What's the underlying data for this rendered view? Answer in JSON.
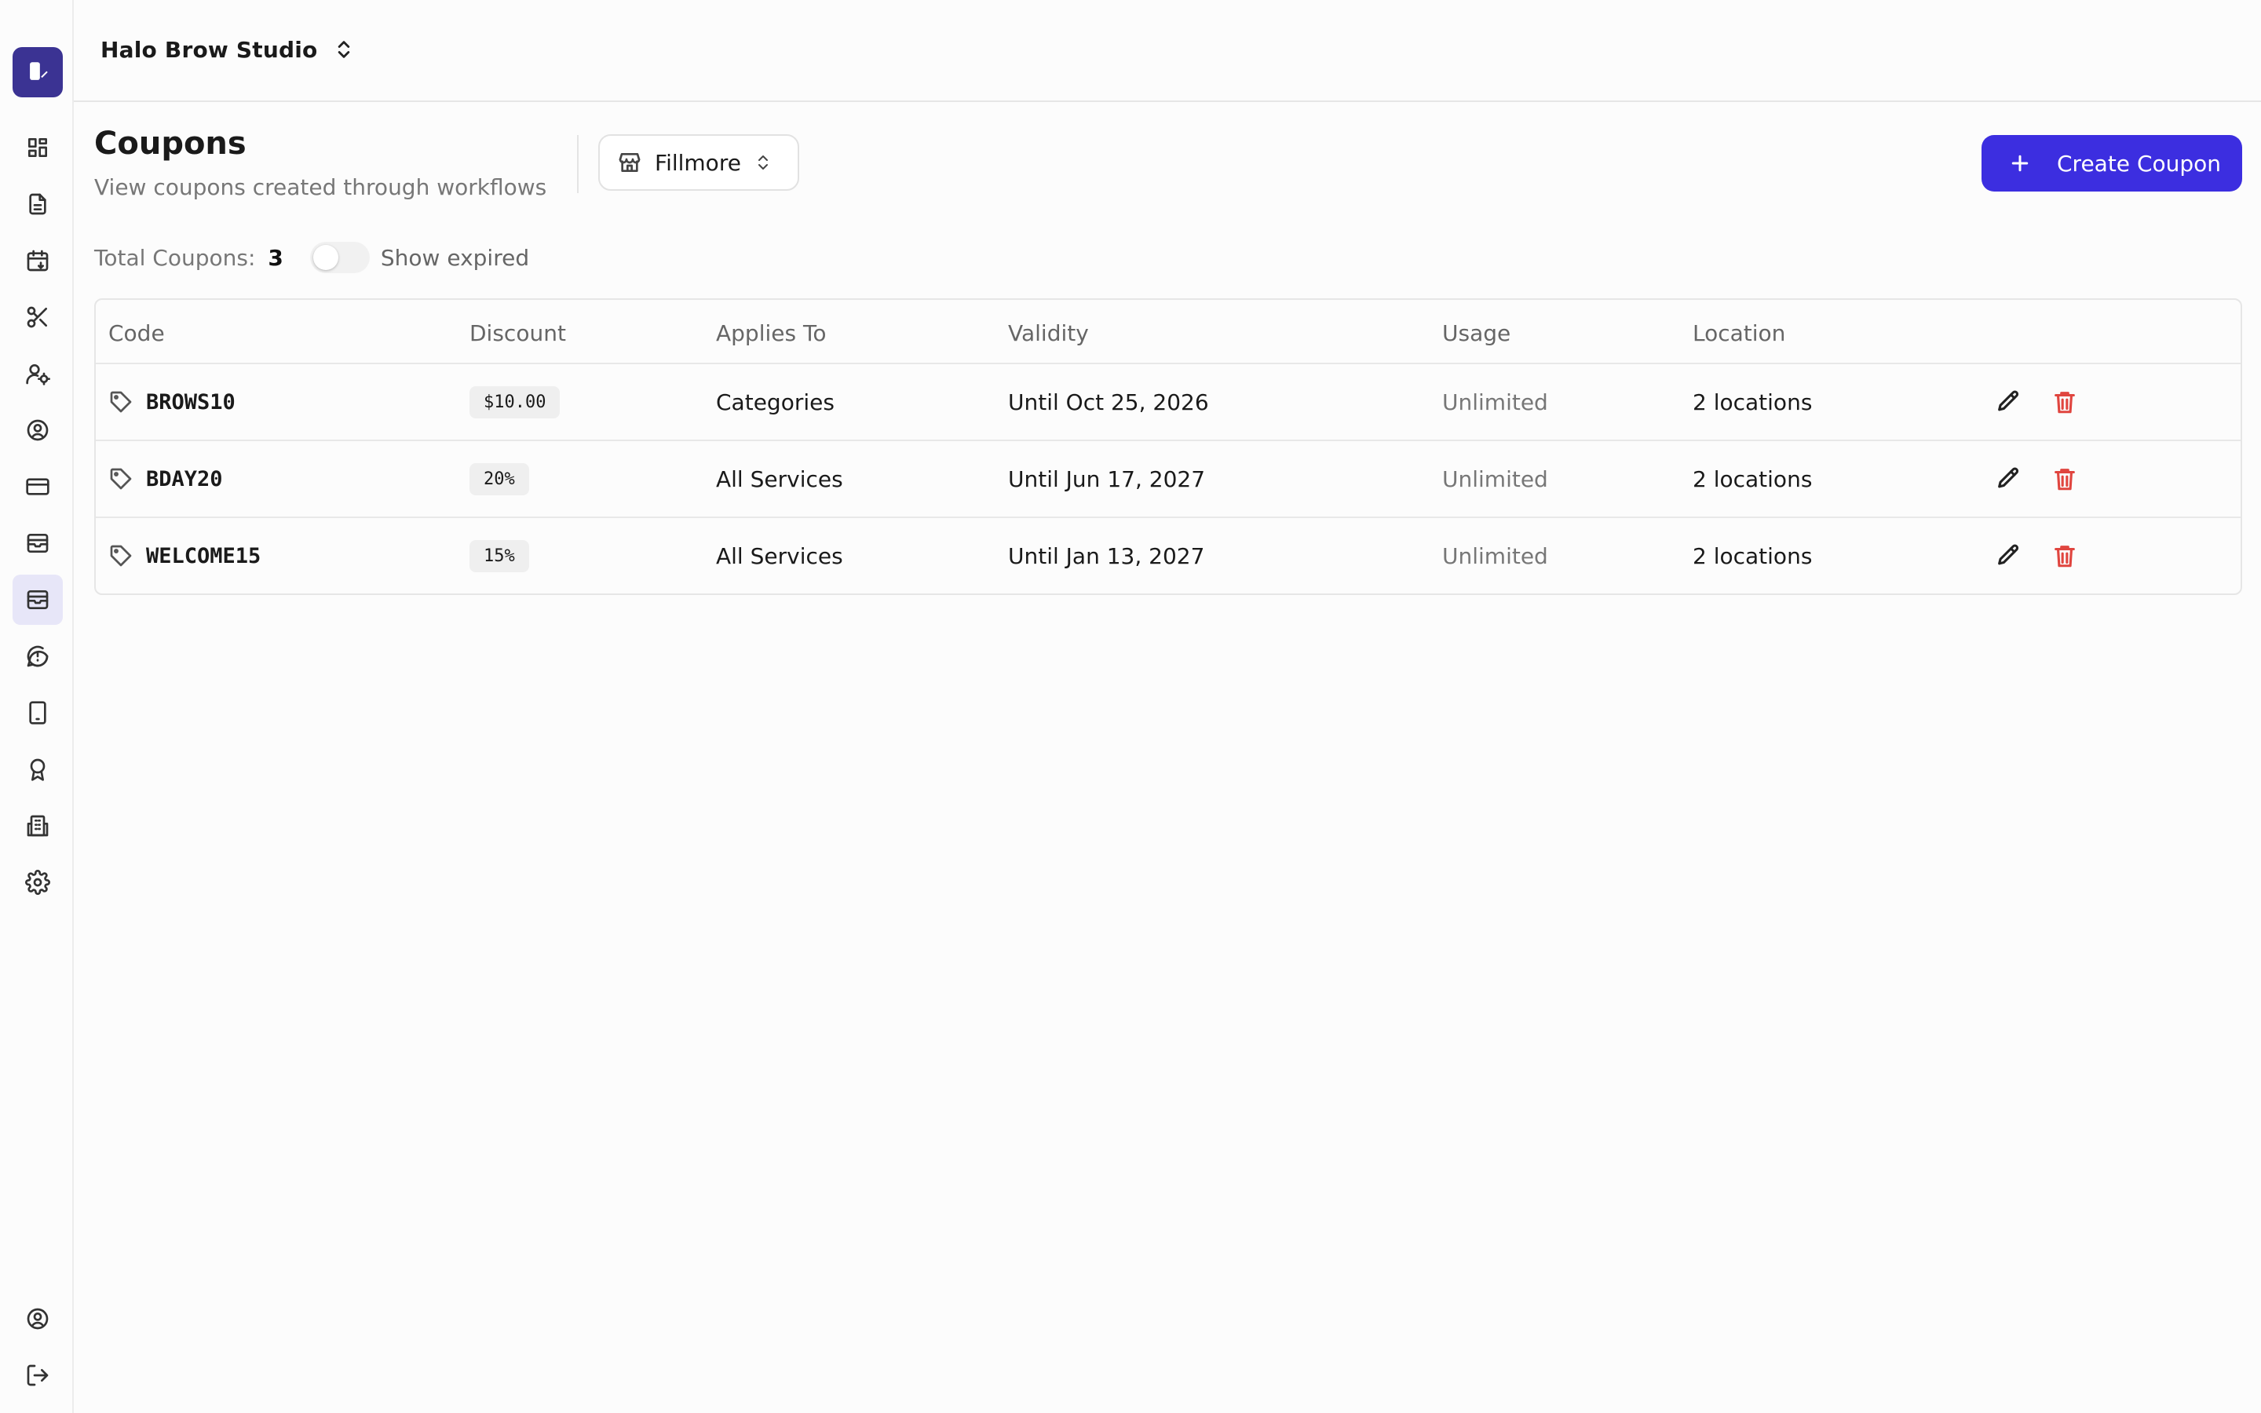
{
  "header": {
    "studio_name": "Halo Brow Studio"
  },
  "page": {
    "title": "Coupons",
    "subtitle": "View coupons created through workflows"
  },
  "location_select": {
    "value": "Fillmore"
  },
  "create_button": {
    "label": "Create Coupon"
  },
  "summary": {
    "total_label": "Total Coupons:",
    "total_count": "3",
    "show_expired_label": "Show expired",
    "show_expired_on": false
  },
  "table": {
    "columns": [
      "Code",
      "Discount",
      "Applies To",
      "Validity",
      "Usage",
      "Location"
    ],
    "rows": [
      {
        "code": "BROWS10",
        "discount": "$10.00",
        "applies_to": "Categories",
        "validity": "Until Oct 25, 2026",
        "usage": "Unlimited",
        "location": "2 locations"
      },
      {
        "code": "BDAY20",
        "discount": "20%",
        "applies_to": "All Services",
        "validity": "Until Jun 17, 2027",
        "usage": "Unlimited",
        "location": "2 locations"
      },
      {
        "code": "WELCOME15",
        "discount": "15%",
        "applies_to": "All Services",
        "validity": "Until Jan 13, 2027",
        "usage": "Unlimited",
        "location": "2 locations"
      }
    ]
  },
  "sidebar": {
    "items": [
      {
        "icon": "dashboard-icon"
      },
      {
        "icon": "document-icon"
      },
      {
        "icon": "calendar-icon"
      },
      {
        "icon": "scissors-icon"
      },
      {
        "icon": "staff-icon"
      },
      {
        "icon": "user-circle-icon"
      },
      {
        "icon": "credit-card-icon"
      },
      {
        "icon": "archive-icon"
      },
      {
        "icon": "coupons-icon",
        "active": true
      },
      {
        "icon": "chat-icon"
      },
      {
        "icon": "tablet-icon"
      },
      {
        "icon": "award-icon"
      },
      {
        "icon": "building-icon"
      },
      {
        "icon": "gear-icon"
      }
    ],
    "bottom": [
      {
        "icon": "account-icon"
      },
      {
        "icon": "logout-icon"
      }
    ]
  },
  "colors": {
    "brand": "#3b3393",
    "primary_button": "#3c2ee0",
    "active_nav": "#e7e6f8",
    "delete": "#e0453f"
  }
}
